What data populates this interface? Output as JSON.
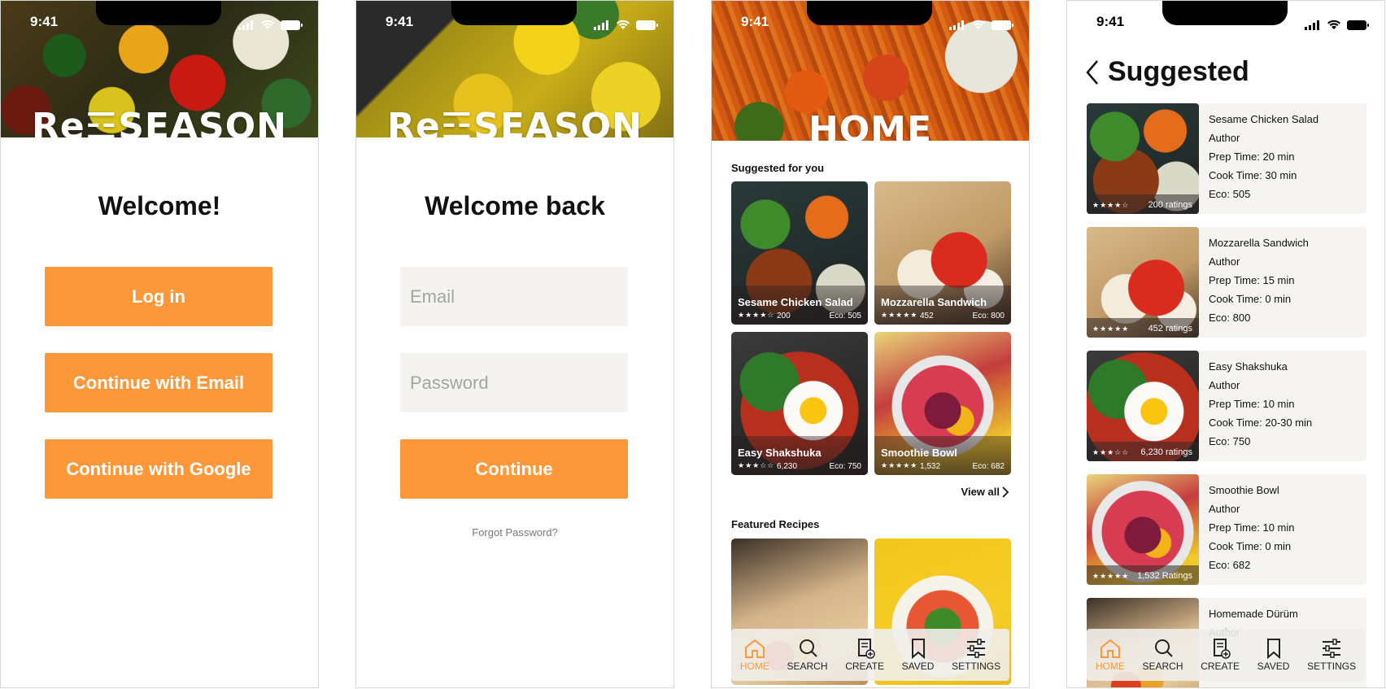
{
  "status": {
    "time": "9:41"
  },
  "brand": {
    "logo_text": "Re☲SEASON"
  },
  "screen1": {
    "title": "Welcome!",
    "buttons": [
      "Log in",
      "Continue with Email",
      "Continue with  Google"
    ]
  },
  "screen2": {
    "title": "Welcome back",
    "email_placeholder": "Email",
    "password_placeholder": "Password",
    "continue_label": "Continue",
    "forgot_label": "Forgot Password?"
  },
  "screen3": {
    "hero_title": "HOME",
    "suggested_title": "Suggested for you",
    "cards": [
      {
        "name": "Sesame Chicken Salad",
        "stars": "★★★★☆",
        "ratings": "200",
        "eco": "Eco: 505"
      },
      {
        "name": "Mozzarella Sandwich",
        "stars": "★★★★★",
        "ratings": "452",
        "eco": "Eco: 800"
      },
      {
        "name": "Easy Shakshuka",
        "stars": "★★★☆☆",
        "ratings": "6,230",
        "eco": "Eco: 750"
      },
      {
        "name": "Smoothie Bowl",
        "stars": "★★★★★",
        "ratings": "1,532",
        "eco": "Eco: 682"
      }
    ],
    "view_all": "View all",
    "featured_title": "Featured Recipes"
  },
  "tabs": [
    "HOME",
    "SEARCH",
    "CREATE",
    "SAVED",
    "SETTINGS"
  ],
  "screen4": {
    "title": "Suggested",
    "items": [
      {
        "name": "Sesame Chicken Salad",
        "author": "Author",
        "prep": "Prep Time: 20 min",
        "cook": "Cook  Time: 30 min",
        "eco": "Eco: 505",
        "stars": "★★★★☆",
        "ratings": "200 ratings"
      },
      {
        "name": "Mozzarella Sandwich",
        "author": "Author",
        "prep": "Prep Time: 15 min",
        "cook": "Cook  Time: 0 min",
        "eco": "Eco: 800",
        "stars": "★★★★★",
        "ratings": "452 ratings"
      },
      {
        "name": "Easy Shakshuka",
        "author": "Author",
        "prep": "Prep Time: 10 min",
        "cook": "Cook  Time: 20-30 min",
        "eco": "Eco: 750",
        "stars": "★★★☆☆",
        "ratings": "6,230 ratings"
      },
      {
        "name": "Smoothie Bowl",
        "author": "Author",
        "prep": "Prep Time: 10 min",
        "cook": "Cook  Time: 0 min",
        "eco": "Eco: 682",
        "stars": "★★★★★",
        "ratings": "1,532 Ratings"
      },
      {
        "name": "Homemade Dürüm",
        "author": "Author"
      }
    ]
  },
  "colors": {
    "accent": "#fd983a",
    "field_bg": "#f5f3ef",
    "card_bg": "#f6f4f0"
  }
}
